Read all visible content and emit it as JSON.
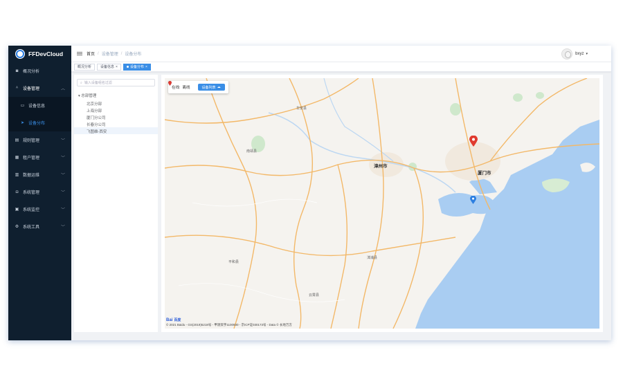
{
  "app": {
    "title": "FFDevCloud"
  },
  "sidebar": {
    "items": [
      {
        "label": "概况分析",
        "icon": "dashboard-icon",
        "expandable": false
      },
      {
        "label": "设备管理",
        "icon": "device-icon",
        "expandable": true,
        "open": true,
        "children": [
          {
            "label": "设备信息",
            "icon": "monitor-icon",
            "active": false
          },
          {
            "label": "设备分布",
            "icon": "location-arrow-icon",
            "active": true
          }
        ]
      },
      {
        "label": "规则管理",
        "icon": "rule-icon",
        "expandable": true
      },
      {
        "label": "租户管理",
        "icon": "tenant-icon",
        "expandable": true
      },
      {
        "label": "数据运维",
        "icon": "data-icon",
        "expandable": true
      },
      {
        "label": "系统管理",
        "icon": "settings-icon",
        "expandable": true
      },
      {
        "label": "系统监控",
        "icon": "monitor-chart-icon",
        "expandable": true
      },
      {
        "label": "系统工具",
        "icon": "tools-icon",
        "expandable": true
      }
    ]
  },
  "header": {
    "breadcrumb": [
      "首页",
      "设备管理",
      "设备分布"
    ],
    "user": "bxyz"
  },
  "tags": [
    {
      "label": "概况分析",
      "active": false,
      "closable": false
    },
    {
      "label": "设备信息",
      "active": false,
      "closable": true
    },
    {
      "label": "设备分布",
      "active": true,
      "closable": true
    }
  ],
  "tree": {
    "search_placeholder": "输入设备组名过滤",
    "root": "总部管理",
    "nodes": [
      "北京分部",
      "上海分部",
      "厦门分公司",
      "长春分公司",
      "飞图维-西安"
    ],
    "selected_index": 4
  },
  "map": {
    "legend": {
      "online_label": "在线:",
      "offline_label": "离线",
      "button_label": "设备列表"
    },
    "colors": {
      "online_pin": "#2d7fe0",
      "offline_pin": "#e03b2f",
      "sea": "#a9cdf2",
      "road": "#f3b868",
      "land": "#f5f3ef"
    },
    "places": [
      {
        "name": "漳州市",
        "kind": "city"
      },
      {
        "name": "厦门市",
        "kind": "city"
      },
      {
        "name": "南靖县",
        "kind": "county"
      },
      {
        "name": "平和县",
        "kind": "county"
      },
      {
        "name": "漳浦县",
        "kind": "county"
      },
      {
        "name": "云霄县",
        "kind": "county"
      },
      {
        "name": "华安县",
        "kind": "county"
      }
    ],
    "logo_text": {
      "prefix": "Bai",
      "suffix": "百度"
    },
    "attribution": "© 2021 Baidu - GS(2019)5218号 - 甲测资字1100930 - 京ICP证030173号 - Data © 长地万方"
  }
}
